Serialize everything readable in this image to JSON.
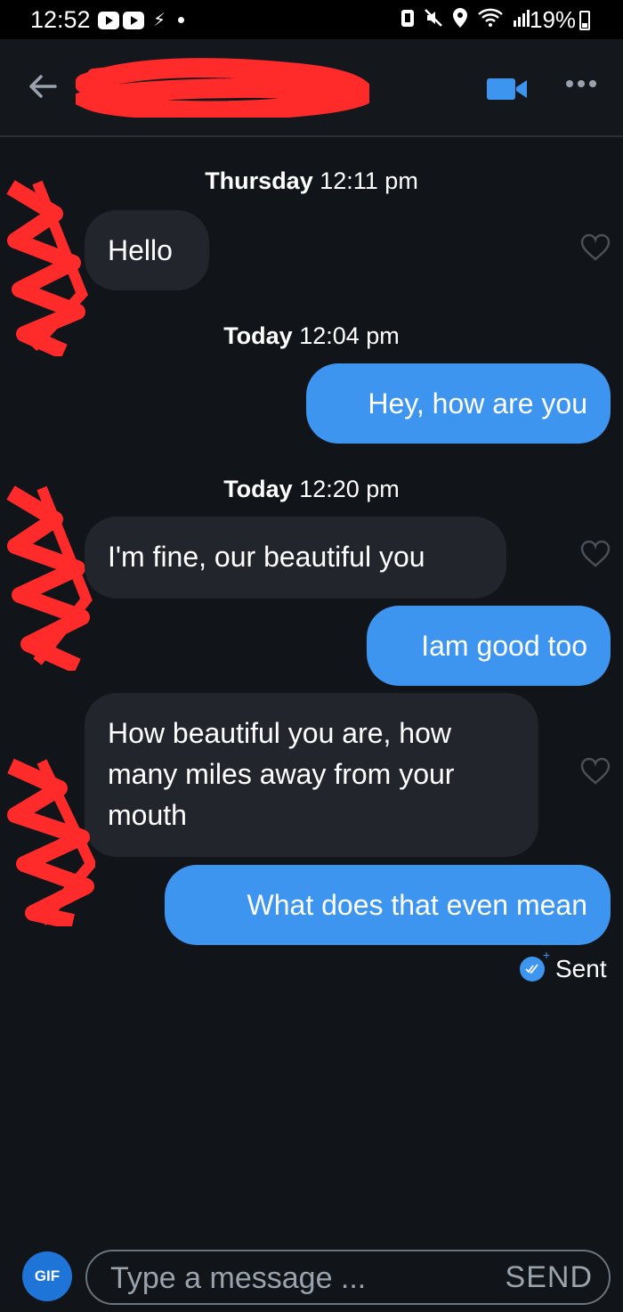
{
  "status_bar": {
    "time": "12:52",
    "battery": "19%"
  },
  "header": {
    "back_icon": "arrow-left-icon",
    "video_icon": "video-camera-icon",
    "more_icon": "more-dots-icon",
    "accent": "#3d95f0"
  },
  "messages": {
    "ts1": {
      "day": "Thursday",
      "time": "12:11 pm"
    },
    "m1": "Hello",
    "ts2": {
      "day": "Today",
      "time": "12:04 pm"
    },
    "m2": "Hey, how are you",
    "ts3": {
      "day": "Today",
      "time": "12:20 pm"
    },
    "m3": "I'm fine, our beautiful you",
    "m4": "Iam good too",
    "m5": "How beautiful you are, how many miles away from your mouth",
    "m6": "What does that even mean",
    "status": "Sent"
  },
  "composer": {
    "gif_label": "GIF",
    "placeholder": "Type a message ...",
    "send_label": "SEND"
  },
  "colors": {
    "background": "#111418",
    "incoming_bubble": "#22262c",
    "outgoing_bubble": "#3d95f0",
    "redaction": "#ff2a2a"
  }
}
